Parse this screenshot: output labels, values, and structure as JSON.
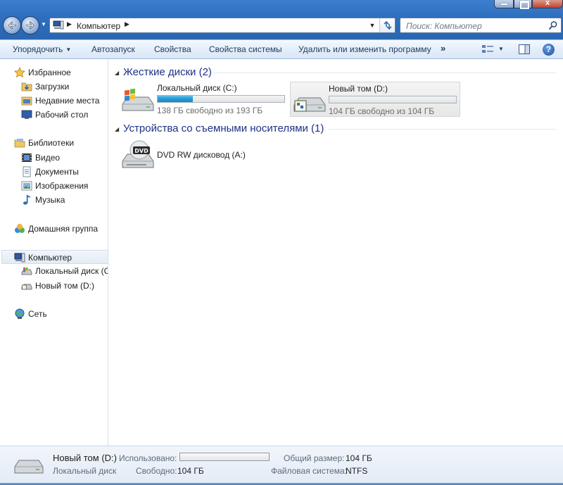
{
  "address": {
    "crumb": "Компьютер",
    "search_placeholder": "Поиск: Компьютер"
  },
  "window_controls": {
    "close": "x"
  },
  "toolbar": {
    "organize": "Упорядочить",
    "autoplay": "Автозапуск",
    "properties": "Свойства",
    "system_properties": "Свойства системы",
    "uninstall": "Удалить или изменить программу",
    "more": "»",
    "help": "?"
  },
  "sidebar": {
    "favorites": "Избранное",
    "downloads": "Загрузки",
    "recent": "Недавние места",
    "desktop": "Рабочий стол",
    "libraries": "Библиотеки",
    "videos": "Видео",
    "documents": "Документы",
    "pictures": "Изображения",
    "music": "Музыка",
    "homegroup": "Домашняя группа",
    "computer": "Компьютер",
    "local_disk": "Локальный диск (С",
    "new_volume": "Новый том (D:)",
    "network": "Сеть"
  },
  "groups": {
    "hard_disks": "Жесткие диски (2)",
    "removable": "Устройства со съемными носителями (1)"
  },
  "drives": {
    "c": {
      "name": "Локальный диск (C:)",
      "free": "138 ГБ свободно из 193 ГБ",
      "used_fraction": 0.28
    },
    "d": {
      "name": "Новый том (D:)",
      "free": "104 ГБ свободно из 104 ГБ",
      "used_fraction": 0.0
    },
    "dvd": {
      "name": "DVD RW дисковод (A:)",
      "badge": "DVD"
    }
  },
  "details": {
    "name": "Новый том (D:)",
    "kind": "Локальный диск",
    "used_label": "Использовано:",
    "used_fraction": 0.0,
    "free_label": "Свободно:",
    "free_value": "104 ГБ",
    "total_label": "Общий размер:",
    "total_value": "104 ГБ",
    "fs_label": "Файловая система:",
    "fs_value": "NTFS"
  },
  "colors": {
    "accent": "#1e3287",
    "bar_fill": "#2a9bd6"
  }
}
